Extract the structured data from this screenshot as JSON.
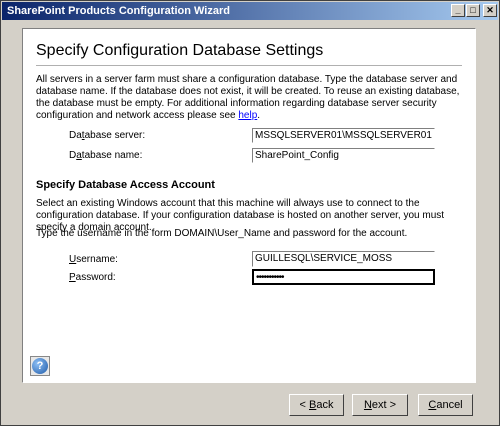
{
  "window": {
    "title": "SharePoint Products Configuration Wizard",
    "minimize_glyph": "_",
    "maximize_glyph": "□",
    "close_glyph": "✕"
  },
  "page": {
    "heading": "Specify Configuration Database Settings",
    "intro_text": "All servers in a server farm must share a configuration database. Type the database server and database name. If the database does not exist, it will be created. To reuse an existing database, the database must be empty. For additional information regarding database server security configuration and network access please see",
    "help_link": "help",
    "intro_end": ".",
    "db_server_label_pre": "Da",
    "db_server_label_u": "t",
    "db_server_label_post": "abase server:",
    "db_server_value": "MSSQLSERVER01\\MSSQLSERVER01",
    "db_name_label_pre": "D",
    "db_name_label_u": "a",
    "db_name_label_post": "tabase name:",
    "db_name_value": "SharePoint_Config",
    "account_heading": "Specify Database Access Account",
    "account_text": "Select an existing Windows account that this machine will always use to connect to the configuration database.  If your configuration database is hosted on another server, you must specify a domain account.",
    "account_format_text": "Type the username in the form DOMAIN\\User_Name and password for the account.",
    "username_label_pre": "",
    "username_label_u": "U",
    "username_label_post": "sername:",
    "username_value": "GUILLESQL\\SERVICE_MOSS",
    "password_label_pre": "",
    "password_label_u": "P",
    "password_label_post": "assword:",
    "password_value": "•••••••••••"
  },
  "help_icon": "?",
  "buttons": {
    "back_pre": "< ",
    "back_u": "B",
    "back_post": "ack",
    "next_u": "N",
    "next_post": "ext  >",
    "cancel_u": "C",
    "cancel_post": "ancel"
  }
}
